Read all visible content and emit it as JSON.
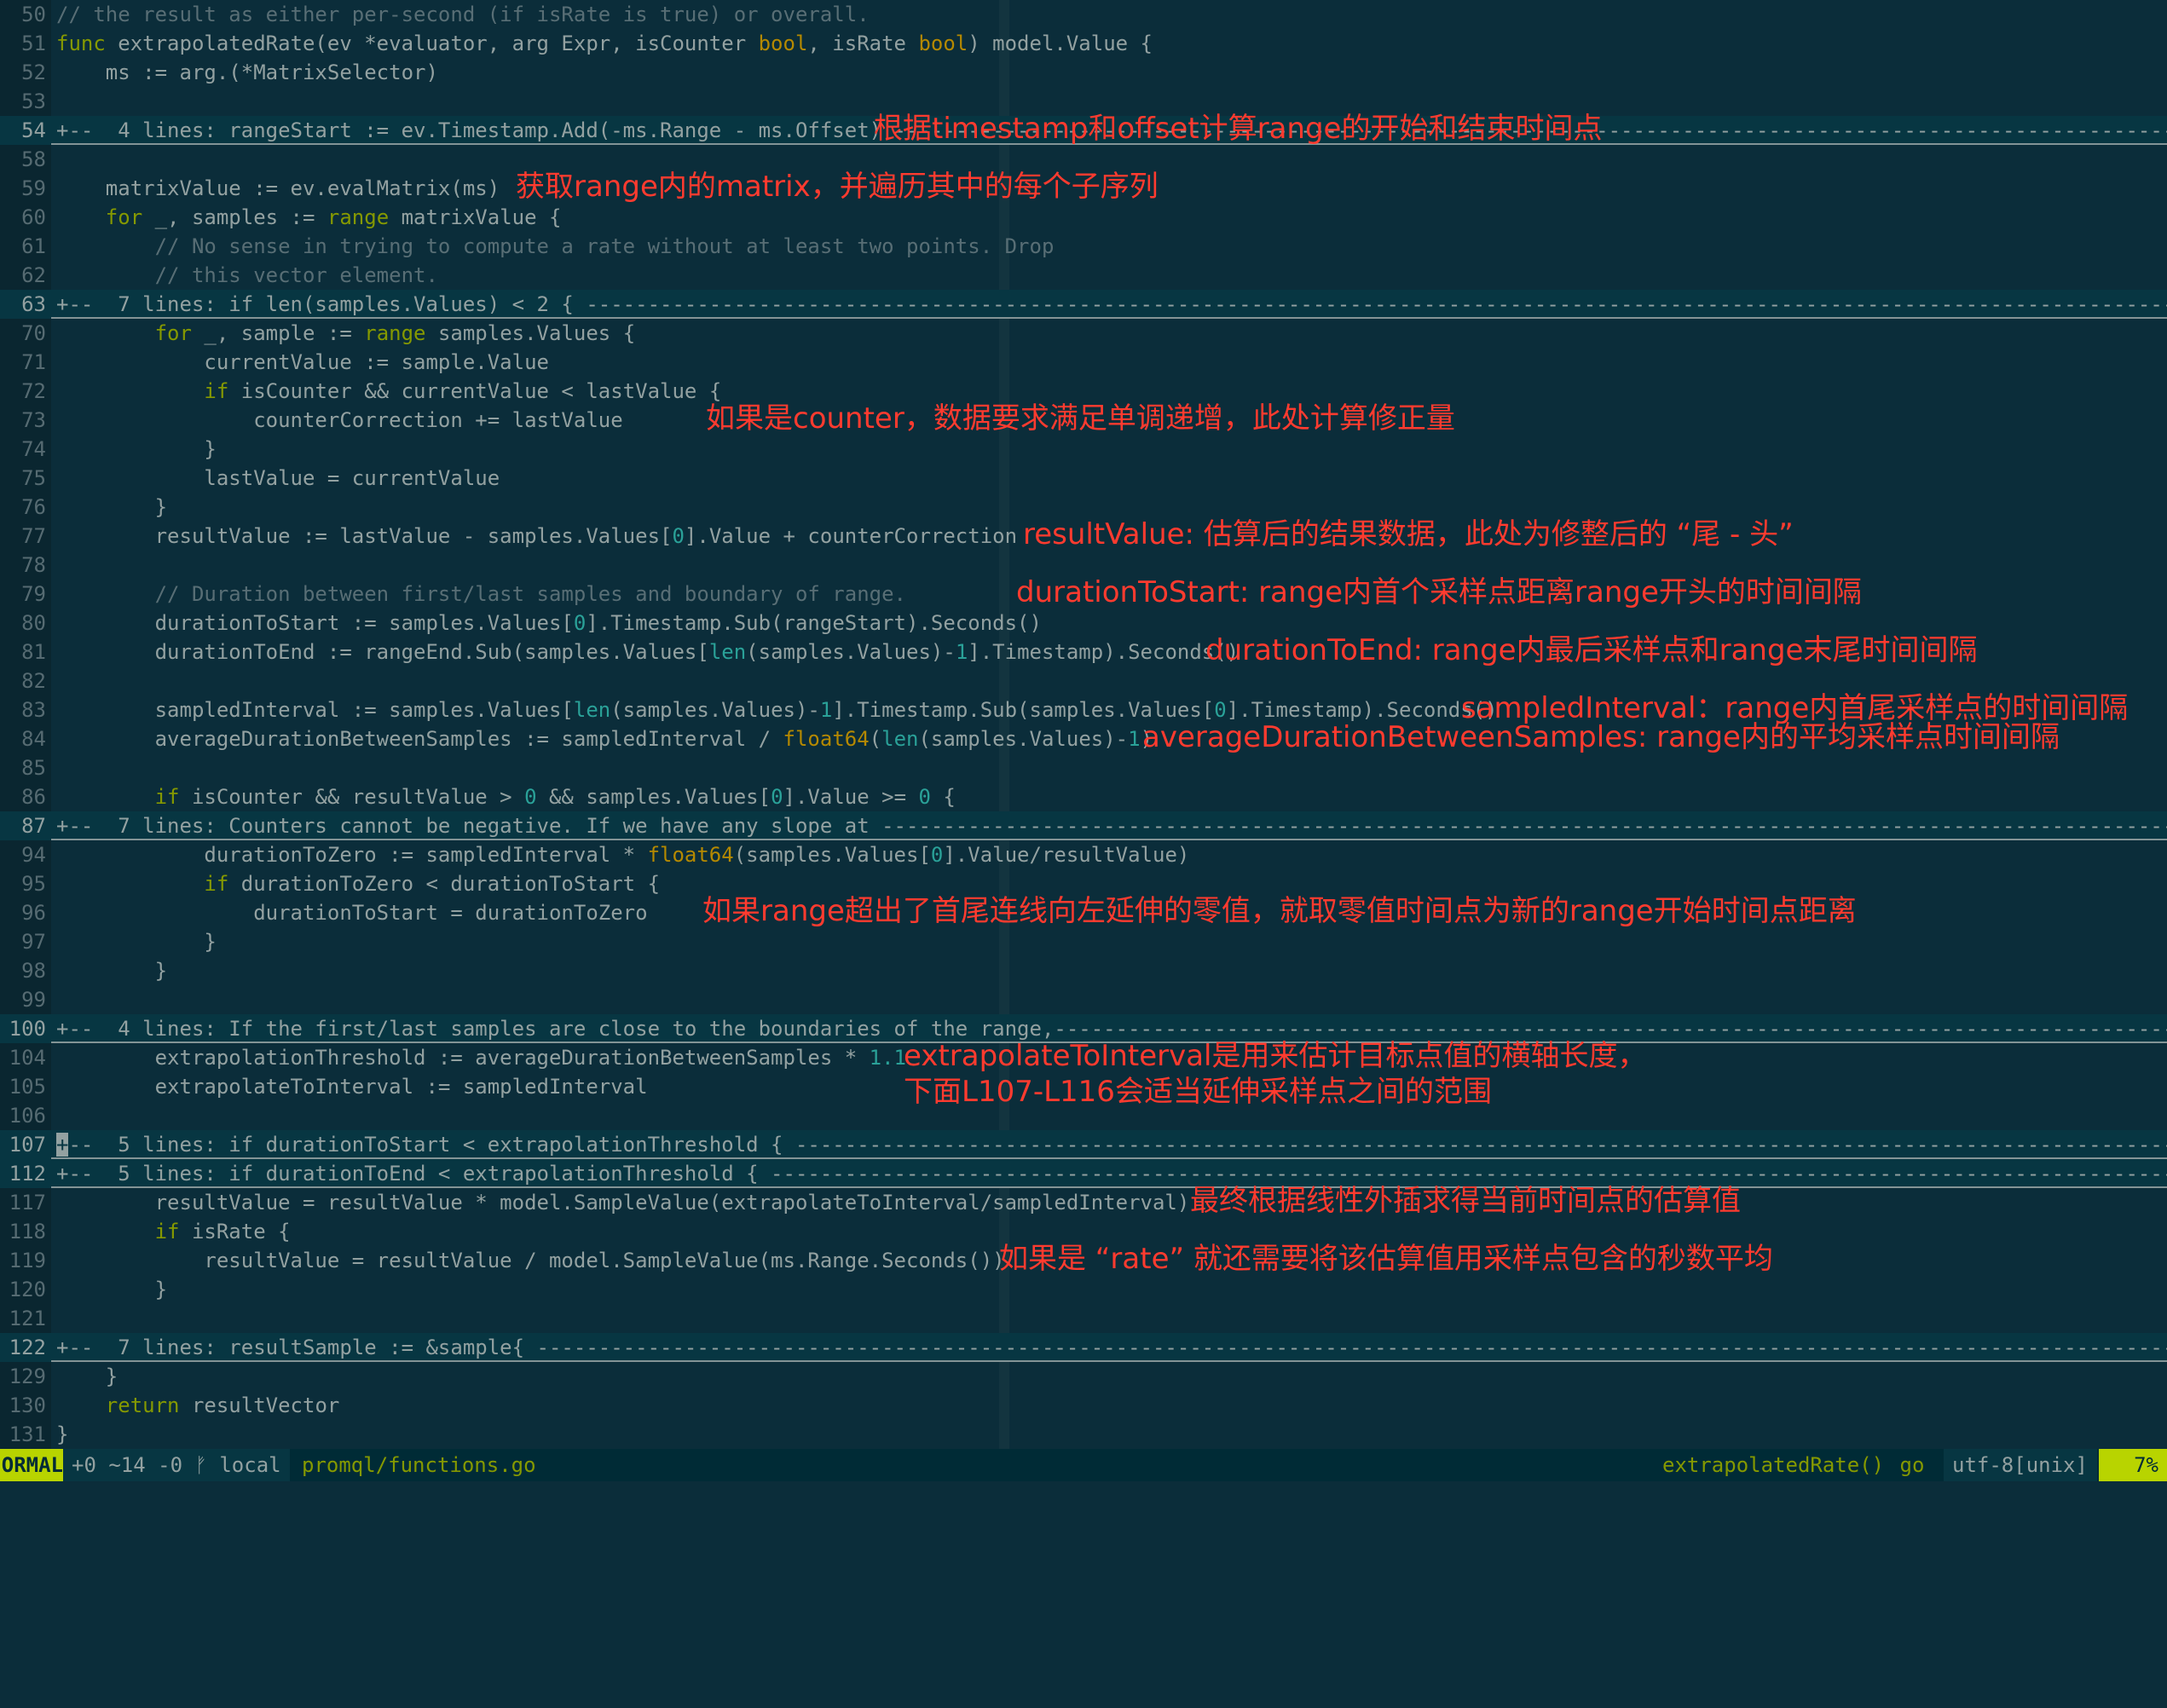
{
  "code_lines": [
    {
      "n": "50",
      "fold": false,
      "t": [
        [
          "cm",
          "// the result as either per-second (if isRate is true) or overall."
        ]
      ]
    },
    {
      "n": "51",
      "fold": false,
      "t": [
        [
          "kw",
          "func"
        ],
        [
          "id",
          " extrapolatedRate(ev *evaluator, arg Expr, isCounter "
        ],
        [
          "ty",
          "bool"
        ],
        [
          "id",
          ", isRate "
        ],
        [
          "ty",
          "bool"
        ],
        [
          "id",
          ") model.Value {"
        ]
      ]
    },
    {
      "n": "52",
      "fold": false,
      "t": [
        [
          "id",
          "    ms := arg.(*MatrixSelector)"
        ]
      ]
    },
    {
      "n": "53",
      "fold": false,
      "t": []
    },
    {
      "n": "54",
      "fold": true,
      "t": [
        [
          "id",
          "+--  4 lines: rangeStart := ev.Timestamp.Add(-ms.Range - ms.Offset) ---------------------------------------------------------------------------------------------------------------------------------------------"
        ]
      ]
    },
    {
      "n": "58",
      "fold": false,
      "t": []
    },
    {
      "n": "59",
      "fold": false,
      "t": [
        [
          "id",
          "    matrixValue := ev.evalMatrix(ms)"
        ]
      ]
    },
    {
      "n": "60",
      "fold": false,
      "t": [
        [
          "id",
          "    "
        ],
        [
          "kw",
          "for"
        ],
        [
          "id",
          " _, samples := "
        ],
        [
          "kw",
          "range"
        ],
        [
          "id",
          " matrixValue {"
        ]
      ]
    },
    {
      "n": "61",
      "fold": false,
      "t": [
        [
          "cm",
          "        // No sense in trying to compute a rate without at least two points. Drop"
        ]
      ]
    },
    {
      "n": "62",
      "fold": false,
      "t": [
        [
          "cm",
          "        // this vector element."
        ]
      ]
    },
    {
      "n": "63",
      "fold": true,
      "t": [
        [
          "id",
          "+--  7 lines: if len(samples.Values) < 2 { -----------------------------------------------------------------------------------------------------------------------------------------------------------------------"
        ]
      ]
    },
    {
      "n": "70",
      "fold": false,
      "t": [
        [
          "id",
          "        "
        ],
        [
          "kw",
          "for"
        ],
        [
          "id",
          " _, sample := "
        ],
        [
          "kw",
          "range"
        ],
        [
          "id",
          " samples.Values {"
        ]
      ]
    },
    {
      "n": "71",
      "fold": false,
      "t": [
        [
          "id",
          "            currentValue := sample.Value"
        ]
      ]
    },
    {
      "n": "72",
      "fold": false,
      "t": [
        [
          "id",
          "            "
        ],
        [
          "kw",
          "if"
        ],
        [
          "id",
          " isCounter && currentValue < lastValue {"
        ]
      ]
    },
    {
      "n": "73",
      "fold": false,
      "t": [
        [
          "id",
          "                counterCorrection += lastValue"
        ]
      ]
    },
    {
      "n": "74",
      "fold": false,
      "t": [
        [
          "id",
          "            }"
        ]
      ]
    },
    {
      "n": "75",
      "fold": false,
      "t": [
        [
          "id",
          "            lastValue = currentValue"
        ]
      ]
    },
    {
      "n": "76",
      "fold": false,
      "t": [
        [
          "id",
          "        }"
        ]
      ]
    },
    {
      "n": "77",
      "fold": false,
      "t": [
        [
          "id",
          "        resultValue := lastValue - samples.Values["
        ],
        [
          "num",
          "0"
        ],
        [
          "id",
          "].Value + counterCorrection"
        ]
      ]
    },
    {
      "n": "78",
      "fold": false,
      "t": []
    },
    {
      "n": "79",
      "fold": false,
      "t": [
        [
          "cm",
          "        // Duration between first/last samples and boundary of range."
        ]
      ]
    },
    {
      "n": "80",
      "fold": false,
      "t": [
        [
          "id",
          "        durationToStart := samples.Values["
        ],
        [
          "num",
          "0"
        ],
        [
          "id",
          "].Timestamp.Sub(rangeStart).Seconds()"
        ]
      ]
    },
    {
      "n": "81",
      "fold": false,
      "t": [
        [
          "id",
          "        durationToEnd := rangeEnd.Sub(samples.Values["
        ],
        [
          "fn",
          "len"
        ],
        [
          "id",
          "(samples.Values)-"
        ],
        [
          "num",
          "1"
        ],
        [
          "id",
          "].Timestamp).Seconds()"
        ]
      ]
    },
    {
      "n": "82",
      "fold": false,
      "t": []
    },
    {
      "n": "83",
      "fold": false,
      "t": [
        [
          "id",
          "        sampledInterval := samples.Values["
        ],
        [
          "fn",
          "len"
        ],
        [
          "id",
          "(samples.Values)-"
        ],
        [
          "num",
          "1"
        ],
        [
          "id",
          "].Timestamp.Sub(samples.Values["
        ],
        [
          "num",
          "0"
        ],
        [
          "id",
          "].Timestamp).Seconds()"
        ]
      ]
    },
    {
      "n": "84",
      "fold": false,
      "t": [
        [
          "id",
          "        averageDurationBetweenSamples := sampledInterval / "
        ],
        [
          "ty",
          "float64"
        ],
        [
          "id",
          "("
        ],
        [
          "fn",
          "len"
        ],
        [
          "id",
          "(samples.Values)-"
        ],
        [
          "num",
          "1"
        ],
        [
          "id",
          ")"
        ]
      ]
    },
    {
      "n": "85",
      "fold": false,
      "t": []
    },
    {
      "n": "86",
      "fold": false,
      "t": [
        [
          "id",
          "        "
        ],
        [
          "kw",
          "if"
        ],
        [
          "id",
          " isCounter && resultValue > "
        ],
        [
          "num",
          "0"
        ],
        [
          "id",
          " && samples.Values["
        ],
        [
          "num",
          "0"
        ],
        [
          "id",
          "].Value >= "
        ],
        [
          "num",
          "0"
        ],
        [
          "id",
          " {"
        ]
      ]
    },
    {
      "n": "87",
      "fold": true,
      "t": [
        [
          "id",
          "+--  7 lines: Counters cannot be negative. If we have any slope at ----------------------------------------------------------------------------------------------------------------------------------------------"
        ]
      ]
    },
    {
      "n": "94",
      "fold": false,
      "t": [
        [
          "id",
          "            durationToZero := sampledInterval * "
        ],
        [
          "ty",
          "float64"
        ],
        [
          "id",
          "(samples.Values["
        ],
        [
          "num",
          "0"
        ],
        [
          "id",
          "].Value/resultValue)"
        ]
      ]
    },
    {
      "n": "95",
      "fold": false,
      "t": [
        [
          "id",
          "            "
        ],
        [
          "kw",
          "if"
        ],
        [
          "id",
          " durationToZero < durationToStart {"
        ]
      ]
    },
    {
      "n": "96",
      "fold": false,
      "t": [
        [
          "id",
          "                durationToStart = durationToZero"
        ]
      ]
    },
    {
      "n": "97",
      "fold": false,
      "t": [
        [
          "id",
          "            }"
        ]
      ]
    },
    {
      "n": "98",
      "fold": false,
      "t": [
        [
          "id",
          "        }"
        ]
      ]
    },
    {
      "n": "99",
      "fold": false,
      "t": []
    },
    {
      "n": "100",
      "fold": true,
      "t": [
        [
          "id",
          "+--  4 lines: If the first/last samples are close to the boundaries of the range,--------------------------------------------------------------------------------------------------------------------------"
        ]
      ]
    },
    {
      "n": "104",
      "fold": false,
      "t": [
        [
          "id",
          "        extrapolationThreshold := averageDurationBetweenSamples * "
        ],
        [
          "num",
          "1.1"
        ]
      ]
    },
    {
      "n": "105",
      "fold": false,
      "t": [
        [
          "id",
          "        extrapolateToInterval := sampledInterval"
        ]
      ]
    },
    {
      "n": "106",
      "fold": false,
      "t": []
    },
    {
      "n": "107",
      "fold": true,
      "cursor": true,
      "t": [
        [
          "id",
          "+--  5 lines: if durationToStart < extrapolationThreshold { ------------------------------------------------------------------------------------------------------------------------------------------------"
        ]
      ]
    },
    {
      "n": "112",
      "fold": true,
      "t": [
        [
          "id",
          "+--  5 lines: if durationToEnd < extrapolationThreshold { --------------------------------------------------------------------------------------------------------------------------------------------------"
        ]
      ]
    },
    {
      "n": "117",
      "fold": false,
      "t": [
        [
          "id",
          "        resultValue = resultValue * model.SampleValue(extrapolateToInterval/sampledInterval)"
        ]
      ]
    },
    {
      "n": "118",
      "fold": false,
      "t": [
        [
          "id",
          "        "
        ],
        [
          "kw",
          "if"
        ],
        [
          "id",
          " isRate {"
        ]
      ]
    },
    {
      "n": "119",
      "fold": false,
      "t": [
        [
          "id",
          "            resultValue = resultValue / model.SampleValue(ms.Range.Seconds())"
        ]
      ]
    },
    {
      "n": "120",
      "fold": false,
      "t": [
        [
          "id",
          "        }"
        ]
      ]
    },
    {
      "n": "121",
      "fold": false,
      "t": []
    },
    {
      "n": "122",
      "fold": true,
      "t": [
        [
          "id",
          "+--  7 lines: resultSample := &sample{ -----------------------------------------------------------------------------------------------------------------------------------------------------------------------------"
        ]
      ]
    },
    {
      "n": "129",
      "fold": false,
      "t": [
        [
          "id",
          "    }"
        ]
      ]
    },
    {
      "n": "130",
      "fold": false,
      "t": [
        [
          "id",
          "    "
        ],
        [
          "kw",
          "return"
        ],
        [
          "id",
          " resultVector"
        ]
      ]
    },
    {
      "n": "131",
      "fold": false,
      "t": [
        [
          "id",
          "}"
        ]
      ]
    }
  ],
  "annotations": [
    {
      "line": 4,
      "col": 1025,
      "text": "根据timestamp和offset计算range的开始和结束时间点"
    },
    {
      "line": 6,
      "col": 605,
      "text": "获取range内的matrix，并遍历其中的每个子序列"
    },
    {
      "line": 14,
      "col": 828,
      "text": "如果是counter，数据要求满足单调递增，此处计算修正量"
    },
    {
      "line": 18,
      "col": 1200,
      "text": "resultValue: 估算后的结果数据，此处为修整后的 “尾 - 头”"
    },
    {
      "line": 20,
      "col": 1192,
      "text": "durationToStart: range内首个采样点距离range开头的时间间隔"
    },
    {
      "line": 22,
      "col": 1414,
      "text": "durationToEnd: range内最后采样点和range末尾时间间隔"
    },
    {
      "line": 24,
      "col": 1714,
      "text": "sampledInterval：range内首尾采样点的时间间隔"
    },
    {
      "line": 25,
      "col": 1340,
      "text": "averageDurationBetweenSamples: range内的平均采样点时间间隔"
    },
    {
      "line": 31,
      "col": 824,
      "text": "如果range超出了首尾连线向左延伸的零值，就取零值时间点为新的range开始时间点距离"
    },
    {
      "line": 36,
      "col": 1060,
      "text": "extrapolateToInterval是用来估计目标点值的横轴长度，\n下面L107-L116会适当延伸采样点之间的范围"
    },
    {
      "line": 41,
      "col": 1396,
      "text": "最终根据线性外插求得当前时间点的估算值"
    },
    {
      "line": 43,
      "col": 1172,
      "text": "如果是 “rate” 就还需要将该估算值用采样点包含的秒数平均"
    }
  ],
  "status": {
    "mode": "ORMAL",
    "git": "+0 ~14 -0 ᚠ local",
    "file": "promql/functions.go",
    "function": "extrapolatedRate()",
    "filetype": "go",
    "encoding": "utf-8[unix]",
    "percent": "7%"
  },
  "colors": {
    "background": "#0b2d3a",
    "keyword": "#859900",
    "type": "#b58900",
    "number": "#2aa198",
    "comment": "#586e75",
    "annotation": "#ff3b2f",
    "mode_bg": "#b8d400"
  }
}
